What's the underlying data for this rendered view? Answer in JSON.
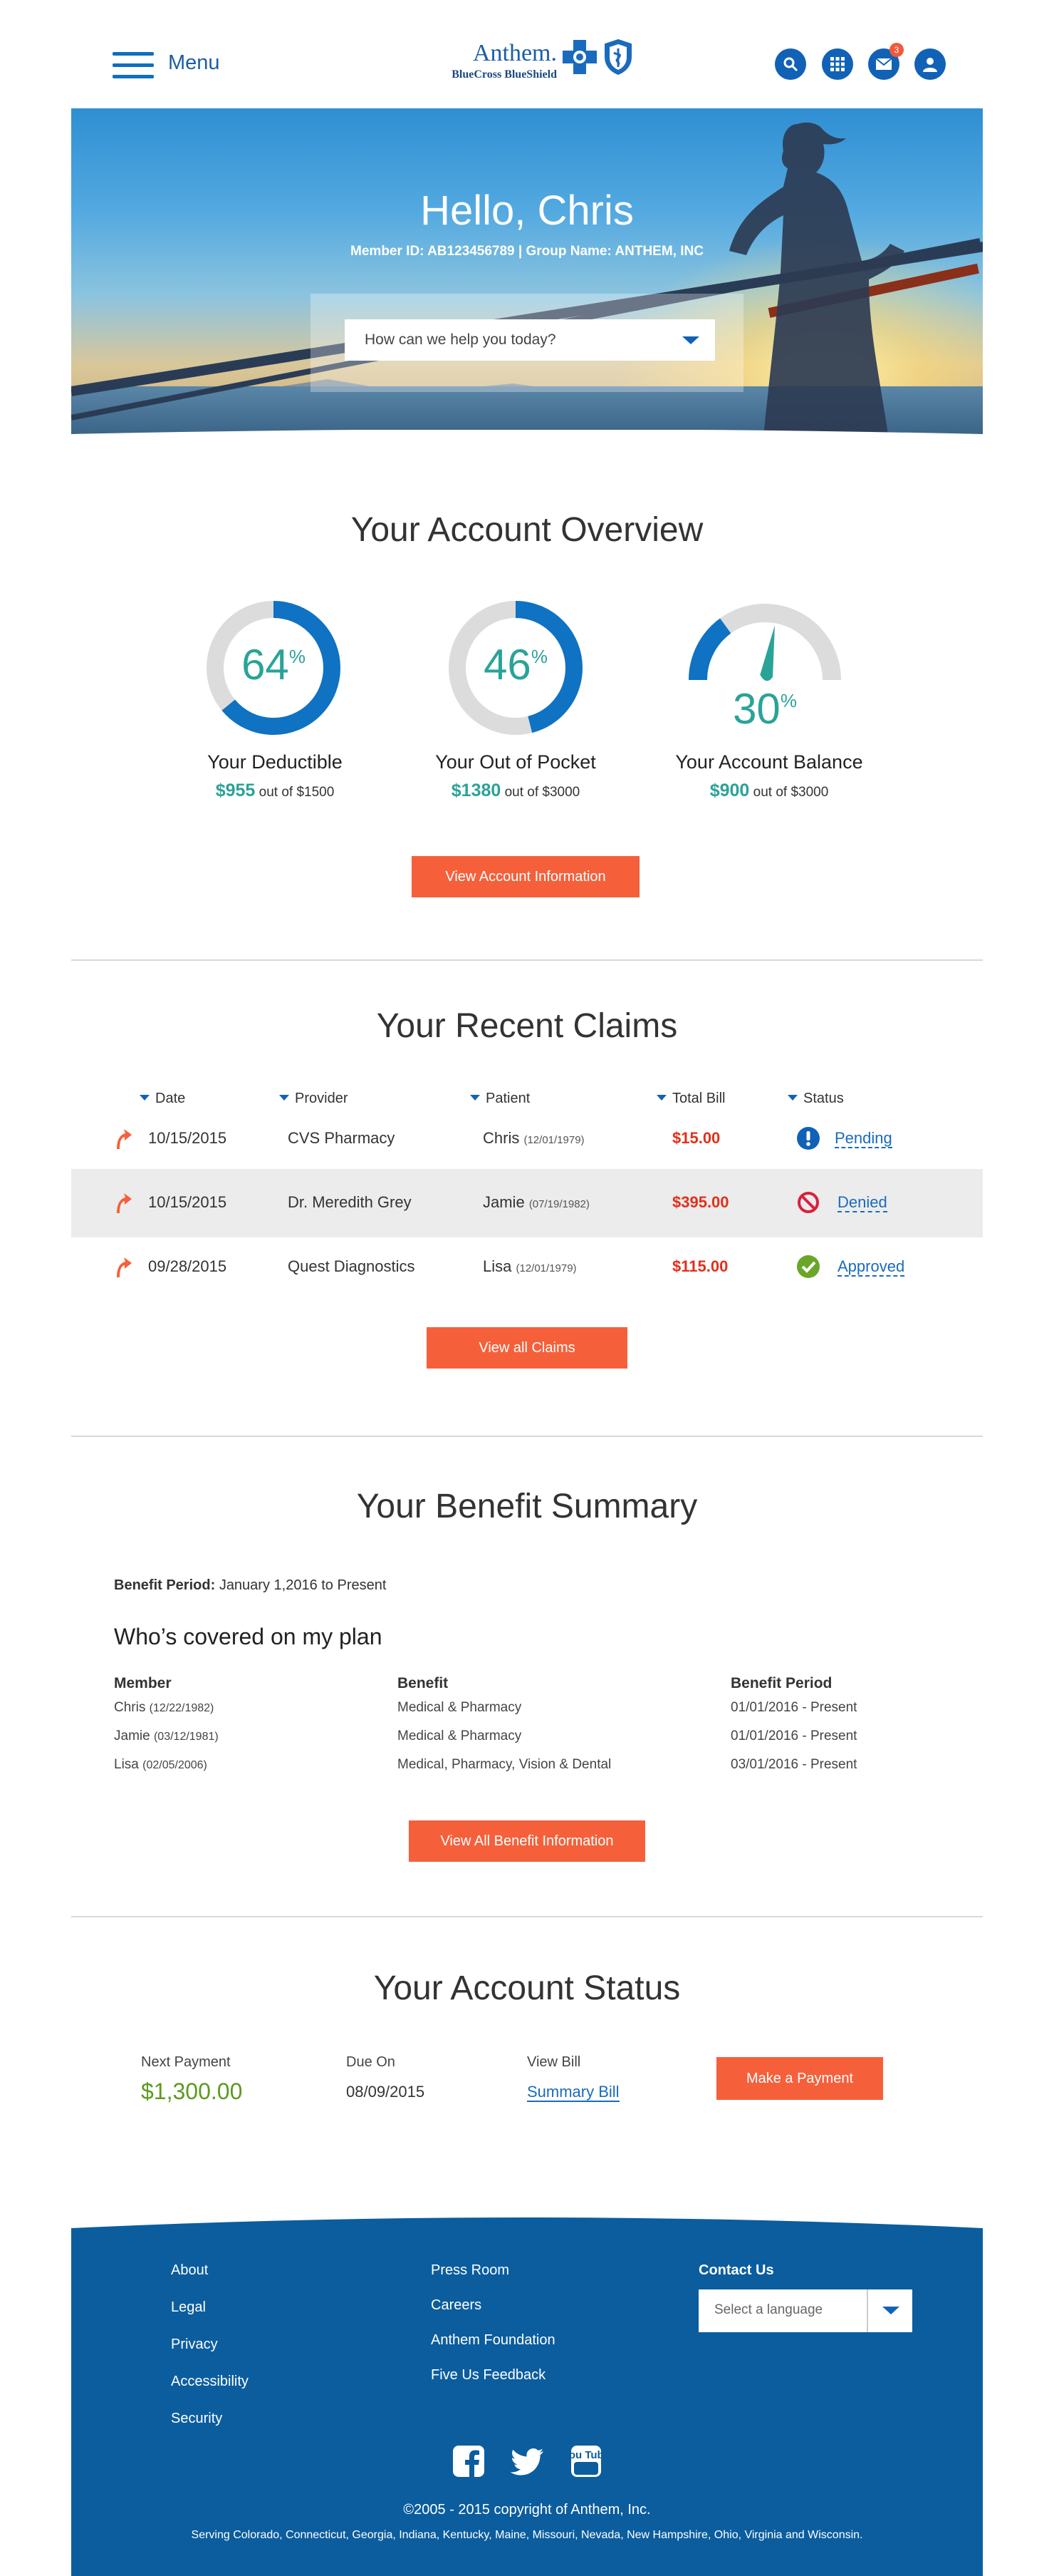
{
  "header": {
    "menu_label": "Menu",
    "logo_word": "Anthem.",
    "logo_sub": "BlueCross BlueShield",
    "icons": [
      "search-icon",
      "apps-grid-icon",
      "mail-icon",
      "user-icon"
    ],
    "mail_badge": "3"
  },
  "hero": {
    "greeting": "Hello, Chris",
    "member_line": "Member ID: AB123456789  |  Group Name:  ANTHEM, INC",
    "help_placeholder": "How can we help you today?"
  },
  "overview": {
    "title": "Your Account Overview",
    "gauges": [
      {
        "pct": "64",
        "pct_value": 64,
        "label": "Your Deductible",
        "amount": "$955",
        "total": "out of $1500"
      },
      {
        "pct": "46",
        "pct_value": 46,
        "label": "Your Out of Pocket",
        "amount": "$1380",
        "total": "out of $3000"
      },
      {
        "pct": "30",
        "pct_value": 30,
        "label": "Your Account Balance",
        "amount": "$900",
        "total": "out of $3000"
      }
    ],
    "pct_sign": "%",
    "button": "View Account Information"
  },
  "claims": {
    "title": "Your Recent Claims",
    "headers": [
      "Date",
      "Provider",
      "Patient",
      "Total Bill",
      "Status"
    ],
    "rows": [
      {
        "date": "10/15/2015",
        "provider": "CVS Pharmacy",
        "patient": "Chris",
        "dob": "(12/01/1979)",
        "bill": "$15.00",
        "status": "Pending",
        "status_icon": "alert-icon"
      },
      {
        "date": "10/15/2015",
        "provider": "Dr. Meredith Grey",
        "patient": "Jamie",
        "dob": "(07/19/1982)",
        "bill": "$395.00",
        "status": "Denied",
        "status_icon": "denied-icon"
      },
      {
        "date": "09/28/2015",
        "provider": "Quest Diagnostics",
        "patient": "Lisa",
        "dob": "(12/01/1979)",
        "bill": "$115.00",
        "status": "Approved",
        "status_icon": "check-icon"
      }
    ],
    "button": "View all Claims"
  },
  "benefits": {
    "title": "Your Benefit Summary",
    "period_label": "Benefit Period:",
    "period_value": "January 1,2016 to Present",
    "subtitle": "Who’s covered on my plan",
    "headers": [
      "Member",
      "Benefit",
      "Benefit Period"
    ],
    "rows": [
      {
        "member": "Chris",
        "dob": "(12/22/1982)",
        "benefit": "Medical & Pharmacy",
        "period": "01/01/2016 - Present"
      },
      {
        "member": "Jamie",
        "dob": "(03/12/1981)",
        "benefit": "Medical & Pharmacy",
        "period": "01/01/2016 - Present"
      },
      {
        "member": "Lisa",
        "dob": "(02/05/2006)",
        "benefit": "Medical, Pharmacy, Vision & Dental",
        "period": "03/01/2016 - Present"
      }
    ],
    "button": "View All Benefit Information"
  },
  "status": {
    "title": "Your Account Status",
    "next_payment_label": "Next Payment",
    "next_payment_value": "$1,300.00",
    "due_label": "Due On",
    "due_value": "08/09/2015",
    "bill_label": "View Bill",
    "bill_link": "Summary Bill",
    "button": "Make a Payment"
  },
  "footer": {
    "col1": [
      "About",
      "Legal",
      "Privacy",
      "Accessibility",
      "Security"
    ],
    "col2": [
      "Press Room",
      "Careers",
      "Anthem Foundation",
      "Five Us Feedback"
    ],
    "contact_label": "Contact Us",
    "language_placeholder": "Select a language",
    "youtube_text": "You Tube",
    "copyright": "©2005 - 2015 copyright of Anthem, Inc.",
    "serving": "Serving Colorado, Connecticut, Georgia, Indiana, Kentucky, Maine, Missouri, Nevada, New Hampshire, Ohio, Virginia and Wisconsin."
  },
  "colors": {
    "brand_blue": "#1162b6",
    "accent_orange": "#f5603b",
    "teal": "#2aa397",
    "footer_blue": "#0b5d9e",
    "bill_red": "#e2301b"
  }
}
